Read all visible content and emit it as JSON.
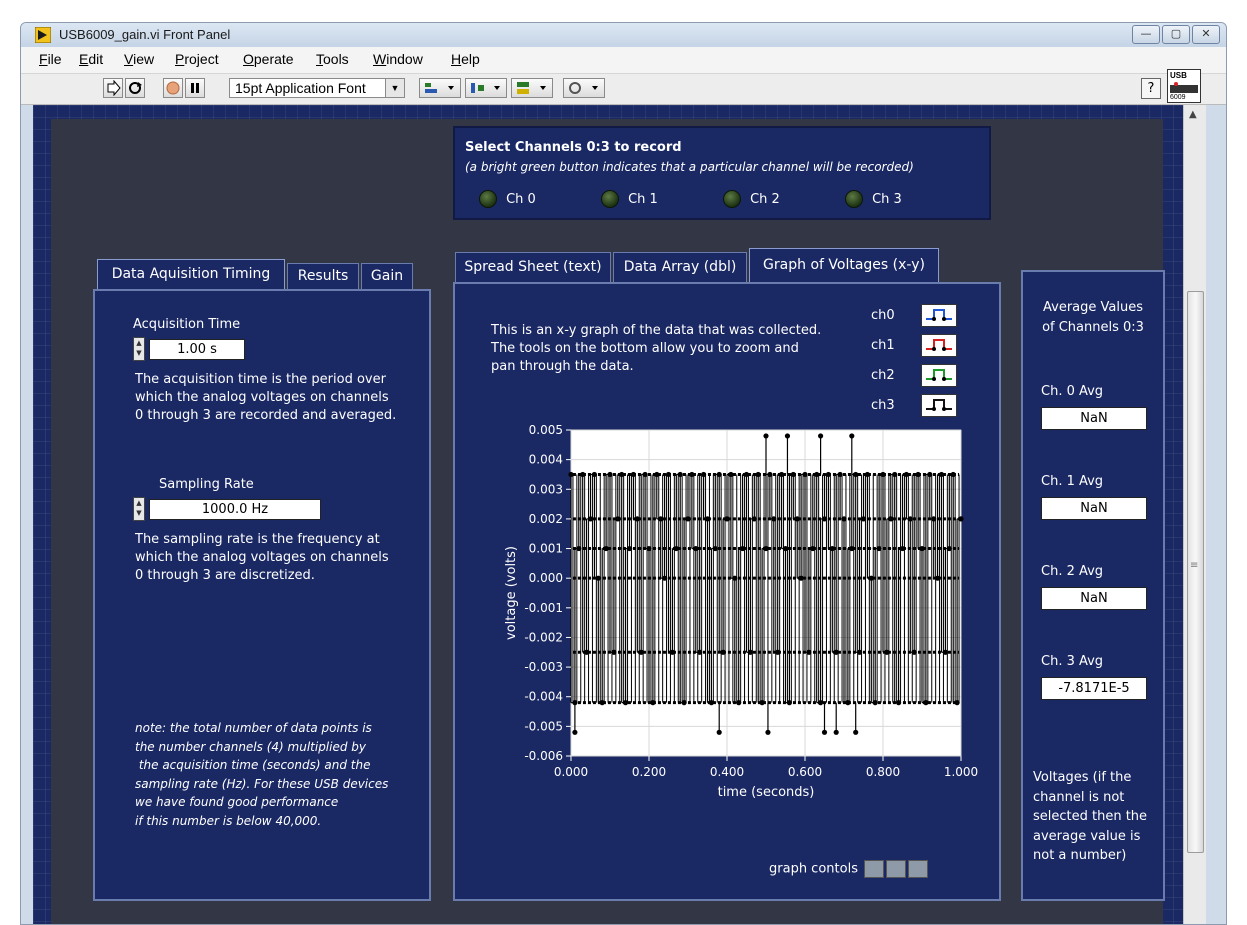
{
  "window": {
    "title": "USB6009_gain.vi Front Panel"
  },
  "menu": [
    {
      "pre": "",
      "u": "F",
      "post": "ile"
    },
    {
      "pre": "",
      "u": "E",
      "post": "dit"
    },
    {
      "pre": "",
      "u": "V",
      "post": "iew"
    },
    {
      "pre": "",
      "u": "P",
      "post": "roject"
    },
    {
      "pre": "",
      "u": "O",
      "post": "perate"
    },
    {
      "pre": "",
      "u": "T",
      "post": "ools"
    },
    {
      "pre": "",
      "u": "W",
      "post": "indow"
    },
    {
      "pre": "",
      "u": "H",
      "post": "elp"
    }
  ],
  "toolbar": {
    "font": "15pt Application Font",
    "help": "?"
  },
  "usb_icon": {
    "line1": "USB",
    "line2": "6009"
  },
  "channels": {
    "title": "Select Channels 0:3 to record",
    "subtitle": "(a bright green button indicates that a particular channel will be recorded)",
    "items": [
      "Ch 0",
      "Ch 1",
      "Ch 2",
      "Ch 3"
    ]
  },
  "left_tabs": [
    "Data Aquisition Timing",
    "Results",
    "Gain"
  ],
  "acquisition": {
    "label": "Acquisition Time",
    "value": "1.00 s",
    "desc": [
      "The acquisition time is the period over",
      "which the  analog voltages on channels",
      "0 through 3 are recorded and averaged."
    ]
  },
  "sampling": {
    "label": "Sampling Rate",
    "value": "1000.0 Hz",
    "desc": [
      "The sampling rate is the frequency at",
      "which the analog voltages on channels",
      "0 through 3 are discretized."
    ]
  },
  "note": [
    "note: the total number of data points is",
    "the number channels (4) multiplied by",
    " the acquisition time (seconds) and the",
    "sampling rate (Hz).  For these USB devices",
    "we have found good performance",
    "if this number is below 40,000."
  ],
  "center_tabs": [
    "Spread Sheet (text)",
    "Data Array (dbl)",
    "Graph of Voltages (x-y)"
  ],
  "graph_desc": [
    "This is an x-y graph of the data that was collected.",
    "The tools on the bottom allow you to zoom and",
    "pan through the data."
  ],
  "plot_legend": [
    {
      "name": "ch0",
      "color": "#1e56d6"
    },
    {
      "name": "ch1",
      "color": "#d62020"
    },
    {
      "name": "ch2",
      "color": "#1e9a2a"
    },
    {
      "name": "ch3",
      "color": "#111111"
    }
  ],
  "graph_controls_label": "graph contols",
  "averages": {
    "title": [
      "Average Values",
      "of Channels 0:3"
    ],
    "items": [
      {
        "label": "Ch. 0 Avg",
        "value": "NaN"
      },
      {
        "label": "Ch. 1 Avg",
        "value": "NaN"
      },
      {
        "label": "Ch. 2 Avg",
        "value": "NaN"
      },
      {
        "label": "Ch. 3 Avg",
        "value": "-7.8171E-5"
      }
    ],
    "note": [
      "Voltages (if the",
      "channel is not",
      "selected then the",
      "average value is",
      "not a number)"
    ]
  },
  "chart_data": {
    "type": "line",
    "xlabel": "time (seconds)",
    "ylabel": "voltage (volts)",
    "xlim": [
      0,
      1
    ],
    "ylim": [
      -0.006,
      0.005
    ],
    "xticks": [
      "0.000",
      "0.200",
      "0.400",
      "0.600",
      "0.800",
      "1.000"
    ],
    "yticks": [
      "0.005",
      "0.004",
      "0.003",
      "0.002",
      "0.001",
      "0.000",
      "-0.001",
      "-0.002",
      "-0.003",
      "-0.004",
      "-0.005",
      "-0.006"
    ],
    "levels": [
      0.0035,
      0.002,
      0.001,
      0.0,
      -0.0025,
      -0.0042
    ],
    "spikes_high": [
      0.5,
      0.555,
      0.64,
      0.72
    ],
    "spikes_low": [
      0.01,
      0.38,
      0.505,
      0.65,
      0.68,
      0.73
    ],
    "series": [
      {
        "name": "ch3",
        "color": "#000000",
        "x": [
          0.0,
          0.01,
          0.02,
          0.03,
          0.04,
          0.05,
          0.06,
          0.07,
          0.08,
          0.09,
          0.1,
          0.11,
          0.12,
          0.13,
          0.14,
          0.15,
          0.16,
          0.17,
          0.18,
          0.19,
          0.2,
          0.21,
          0.22,
          0.23,
          0.24,
          0.25,
          0.26,
          0.27,
          0.28,
          0.29,
          0.3,
          0.31,
          0.32,
          0.33,
          0.34,
          0.35,
          0.36,
          0.37,
          0.38,
          0.39,
          0.4,
          0.41,
          0.42,
          0.43,
          0.44,
          0.45,
          0.46,
          0.47,
          0.48,
          0.49,
          0.5,
          0.51,
          0.52,
          0.53,
          0.54,
          0.55,
          0.56,
          0.57,
          0.58,
          0.59,
          0.6,
          0.61,
          0.62,
          0.63,
          0.64,
          0.65,
          0.66,
          0.67,
          0.68,
          0.69,
          0.7,
          0.71,
          0.72,
          0.73,
          0.74,
          0.75,
          0.76,
          0.77,
          0.78,
          0.79,
          0.8,
          0.81,
          0.82,
          0.83,
          0.84,
          0.85,
          0.86,
          0.87,
          0.88,
          0.89,
          0.9,
          0.91,
          0.92,
          0.93,
          0.94,
          0.95,
          0.96,
          0.97,
          0.98,
          0.99,
          1.0
        ],
        "y": [
          0.0035,
          -0.0042,
          0.001,
          0.0035,
          -0.0025,
          0.002,
          0.0035,
          0.0,
          -0.0042,
          0.001,
          0.0035,
          -0.0025,
          0.002,
          0.0035,
          -0.0042,
          0.001,
          0.0035,
          0.002,
          -0.0025,
          0.0035,
          0.001,
          -0.0042,
          0.0035,
          0.002,
          0.0,
          0.0035,
          -0.0025,
          0.001,
          0.0035,
          -0.0042,
          0.002,
          0.0035,
          0.001,
          -0.0025,
          0.0035,
          0.002,
          -0.0042,
          0.001,
          0.0035,
          -0.0025,
          0.002,
          0.0035,
          0.0,
          -0.0042,
          0.001,
          0.0035,
          -0.0025,
          0.002,
          0.0035,
          -0.0042,
          0.001,
          0.0035,
          0.002,
          -0.0025,
          0.0035,
          0.001,
          -0.0042,
          0.0035,
          0.002,
          0.0,
          0.0035,
          -0.0025,
          0.001,
          0.0035,
          -0.0042,
          0.002,
          0.0035,
          0.001,
          -0.0025,
          0.0035,
          0.002,
          -0.0042,
          0.001,
          0.0035,
          -0.0025,
          0.002,
          0.0035,
          0.0,
          -0.0042,
          0.001,
          0.0035,
          -0.0025,
          0.002,
          0.0035,
          -0.0042,
          0.001,
          0.0035,
          0.002,
          -0.0025,
          0.0035,
          0.001,
          -0.0042,
          0.0035,
          0.002,
          0.0,
          0.0035,
          -0.0025,
          0.001,
          0.0035,
          -0.0042,
          0.002
        ]
      }
    ]
  }
}
